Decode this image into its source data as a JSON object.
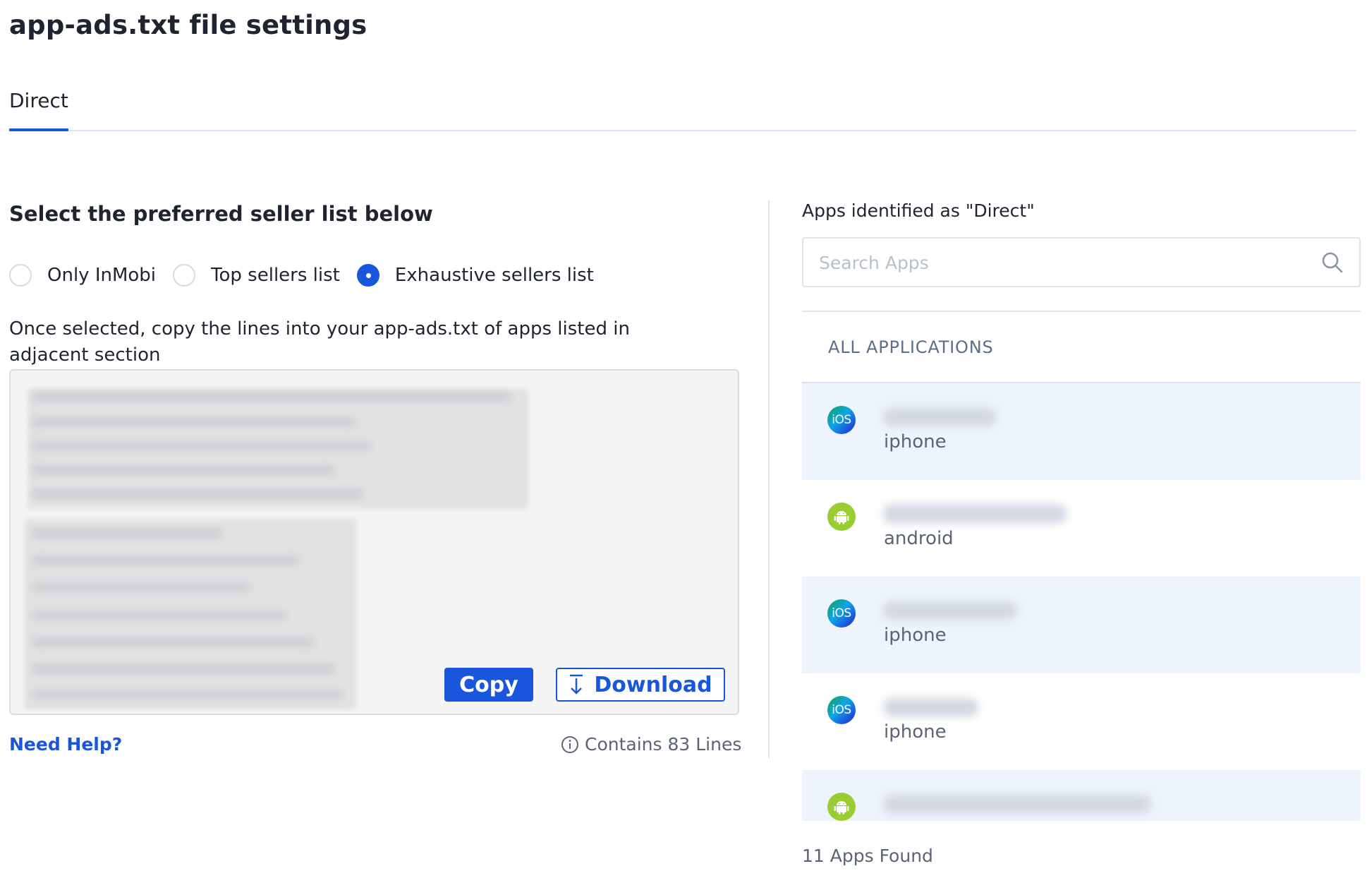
{
  "page": {
    "title": "app-ads.txt file settings"
  },
  "tabs": [
    {
      "label": "Direct",
      "active": true
    }
  ],
  "left": {
    "heading": "Select the preferred seller list below",
    "radio_options": [
      {
        "label": "Only InMobi",
        "checked": false
      },
      {
        "label": "Top sellers list",
        "checked": false
      },
      {
        "label": "Exhaustive sellers list",
        "checked": true
      }
    ],
    "instructions": "Once selected, copy the lines into your app-ads.txt of apps listed in adjacent section",
    "copy_label": "Copy",
    "download_label": "Download",
    "help_link": "Need Help?",
    "line_count": "Contains 83 Lines"
  },
  "right": {
    "title": "Apps identified as \"Direct\"",
    "search_placeholder": "Search Apps",
    "list_header": "ALL APPLICATIONS",
    "apps": [
      {
        "platform": "iphone",
        "icon": "ios-icon"
      },
      {
        "platform": "android",
        "icon": "android-icon"
      },
      {
        "platform": "iphone",
        "icon": "ios-icon"
      },
      {
        "platform": "iphone",
        "icon": "ios-icon"
      },
      {
        "platform": "",
        "icon": "android-icon"
      }
    ],
    "footer": "11 Apps Found"
  },
  "colors": {
    "accent": "#1a56db",
    "shaded_row": "#eef4fd",
    "android_green": "#9acd32"
  }
}
